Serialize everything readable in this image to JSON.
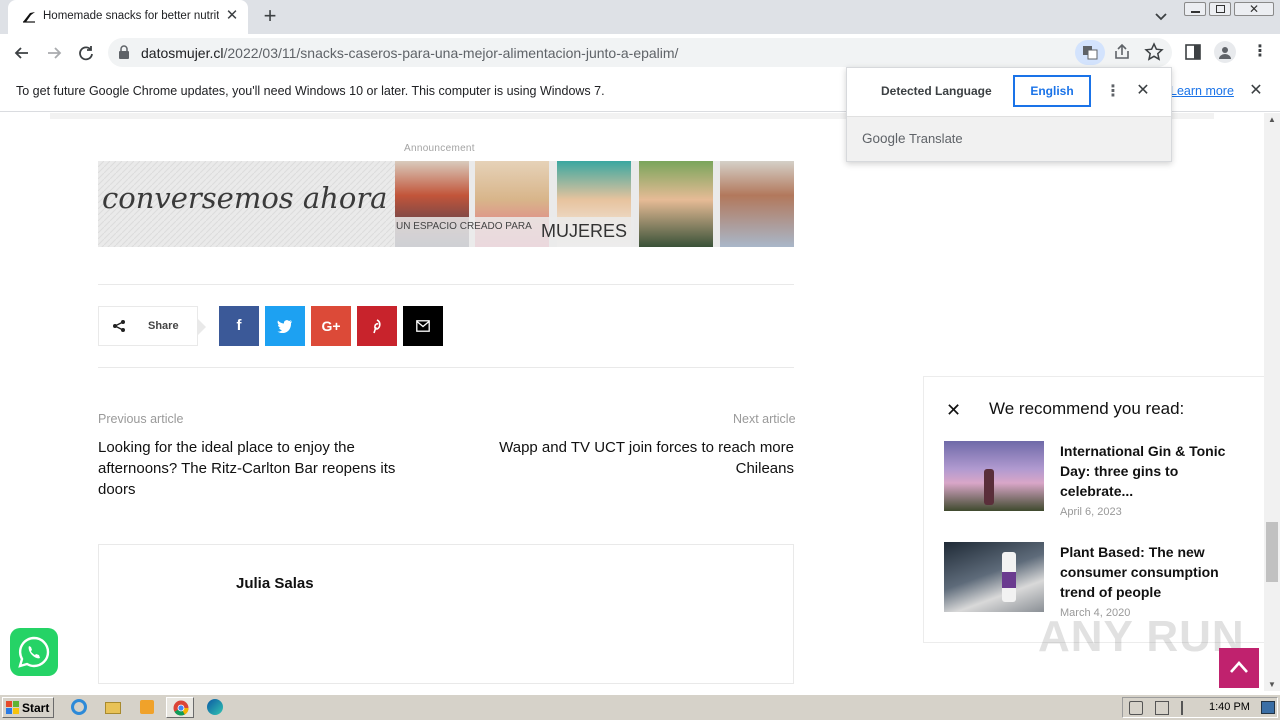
{
  "browser": {
    "tab_title": "Homemade snacks for better nutrition",
    "new_tab_label": "+",
    "url_domain": "datosmujer.cl",
    "url_path": "/2022/03/11/snacks-caseros-para-una-mejor-alimentacion-junto-a-epalim/"
  },
  "infobar": {
    "message": "To get future Google Chrome updates, you'll need Windows 10 or later. This computer is using Windows 7.",
    "learn_more": "Learn more"
  },
  "translate": {
    "detected_tab": "Detected Language",
    "target_tab": "English",
    "brand_google": "Google",
    "brand_translate": "Translate"
  },
  "article": {
    "announcement_label": "Announcement",
    "banner": {
      "title": "conversemos ahora",
      "subtitle": "UN ESPACIO CREADO PARA",
      "highlight": "MUJERES"
    },
    "share_label": "Share",
    "share_buttons": {
      "facebook": "f",
      "googleplus": "G+"
    },
    "prev_label": "Previous article",
    "prev_title": "Looking for the ideal place to enjoy the afternoons? The Ritz-Carlton Bar reopens its doors",
    "next_label": "Next article",
    "next_title": "Wapp and TV UCT join forces to reach more Chileans",
    "author_name": "Julia Salas"
  },
  "recommend": {
    "heading": "We recommend you read:",
    "items": [
      {
        "title": "International Gin & Tonic Day: three gins to celebrate...",
        "date": "April 6, 2023"
      },
      {
        "title": "Plant Based: The new consumer consumption trend of people",
        "date": "March 4, 2020"
      }
    ]
  },
  "watermark": "ANY RUN",
  "taskbar": {
    "start_label": "Start",
    "clock": "1:40 PM"
  },
  "colors": {
    "facebook": "#3b5998",
    "twitter": "#1da1f2",
    "googleplus": "#dc4a38",
    "pinterest": "#c8232c",
    "email": "#000000",
    "accent_pink": "#c0226e",
    "chrome_blue": "#1a73e8"
  }
}
